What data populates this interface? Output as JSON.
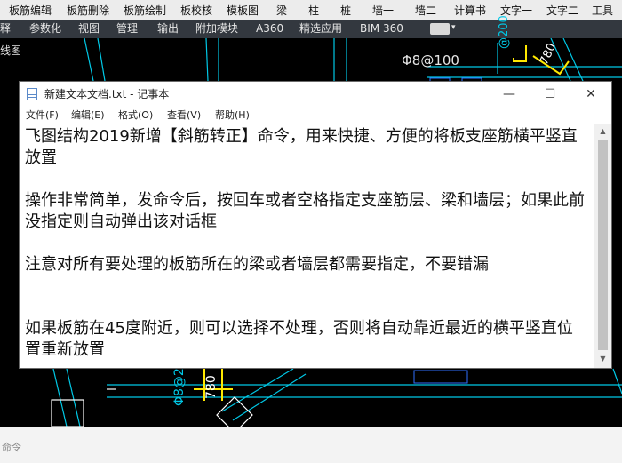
{
  "cad_menu": [
    "板筋编辑",
    "板筋删除",
    "板筋绘制",
    "板校核",
    "模板图",
    "梁",
    "柱",
    "桩",
    "墙一",
    "墙二",
    "计算书",
    "文字一",
    "文字二",
    "工具"
  ],
  "ribbon_tabs": [
    "释",
    "参数化",
    "视图",
    "管理",
    "输出",
    "附加模块",
    "A360",
    "精选应用",
    "BIM 360"
  ],
  "viewport_label": "线图",
  "drawing_labels": {
    "rebar_top": "Φ8@100",
    "rebar_top_right": "@200",
    "dim_top": "780",
    "rebar_bottom": "Φ8@2",
    "dim_bottom": "780"
  },
  "command_line": "命令",
  "notepad": {
    "title": "新建文本文档.txt - 记事本",
    "window_controls": [
      "—",
      "☐",
      "✕"
    ],
    "menu": [
      "文件(F)",
      "编辑(E)",
      "格式(O)",
      "查看(V)",
      "帮助(H)"
    ],
    "paragraphs": [
      "飞图结构2019新增【斜筋转正】命令，用来快捷、方便的将板支座筋横平竖直放置",
      "操作非常简单，发命令后，按回车或者空格指定支座筋层、梁和墙层；如果此前没指定则自动弹出该对话框",
      "注意对所有要处理的板筋所在的梁或者墙层都需要指定，不要错漏",
      "如果板筋在45度附近，则可以选择不处理，否则将自动靠近最近的横平竖直位置重新放置"
    ]
  },
  "colors": {
    "cad_background": "#000000",
    "cyan_lines": "#00c8e6",
    "yellow_lines": "#ffe800",
    "white_lines": "#ffffff"
  }
}
